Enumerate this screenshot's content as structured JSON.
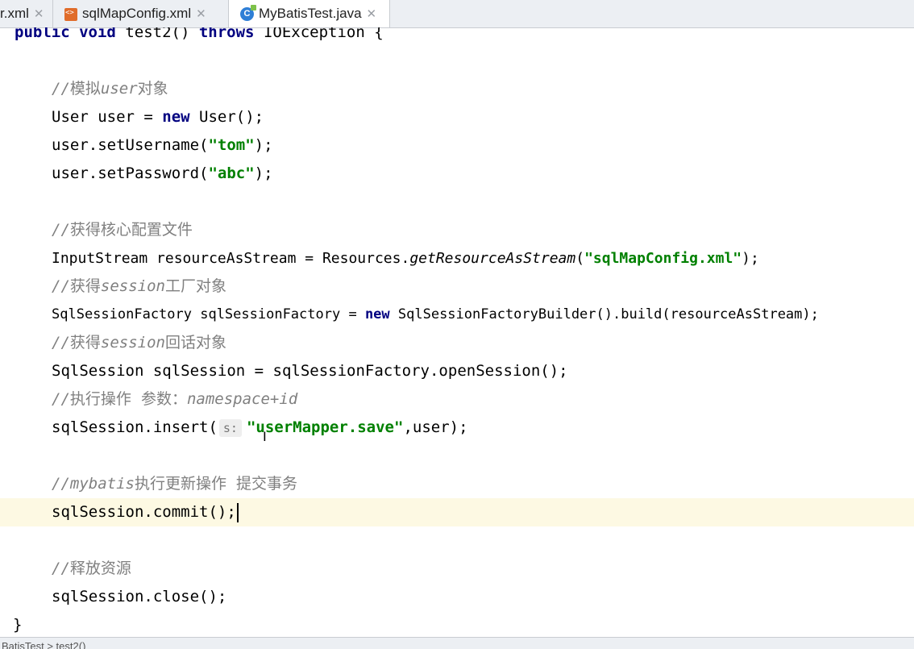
{
  "tabs": [
    {
      "label": "r.xml",
      "icon": "none",
      "active": false
    },
    {
      "label": "sqlMapConfig.xml",
      "icon": "xml-file-icon",
      "active": false
    },
    {
      "label": "MyBatisTest.java",
      "icon": "java-class-icon",
      "active": true
    }
  ],
  "code": {
    "l1": {
      "kw1": "public",
      "kw2": "void",
      "name": "test2()",
      "kw3": "throws",
      "exc": "IOException {"
    },
    "l2": {
      "slashes": "//",
      "c1": "模拟",
      "c2": "user",
      "c3": "对象"
    },
    "l3": {
      "a": "User user = ",
      "kw": "new",
      "b": " User();"
    },
    "l4": {
      "a": "user.setUsername(",
      "s": "\"tom\"",
      "b": ");"
    },
    "l5": {
      "a": "user.setPassword(",
      "s": "\"abc\"",
      "b": ");"
    },
    "l6": {
      "slashes": "//",
      "c1": "获得核心配置文件"
    },
    "l7": {
      "a": "InputStream resourceAsStream = Resources.",
      "m": "getResourceAsStream",
      "b": "(",
      "s": "\"sqlMapConfig.xml\"",
      "c": ");"
    },
    "l8": {
      "slashes": "//",
      "c1": "获得",
      "c2": "session",
      "c3": "工厂对象"
    },
    "l9": {
      "a": "SqlSessionFactory sqlSessionFactory = ",
      "kw": "new",
      "b": " SqlSessionFactoryBuilder().build(resourceAsStream);"
    },
    "l10": {
      "slashes": "//",
      "c1": "获得",
      "c2": "session",
      "c3": "回话对象"
    },
    "l11": {
      "a": "SqlSession sqlSession = sqlSessionFactory.openSession();"
    },
    "l12": {
      "slashes": "//",
      "c1": "执行操作  参数：",
      "c2": "namespace+id"
    },
    "l13": {
      "a": "sqlSession.insert(",
      "hint": "s:",
      "s": "\"userMapper.save\"",
      "b": ",user);"
    },
    "l14": {
      "slashes": "//",
      "c2": "mybatis",
      "c1": "执行更新操作  提交事务"
    },
    "l15": {
      "a": "sqlSession.commit();"
    },
    "l16": {
      "slashes": "//",
      "c1": "释放资源"
    },
    "l17": {
      "a": "sqlSession.close();"
    },
    "l18": {
      "a": "}"
    }
  },
  "status": {
    "text": "BatisTest > test2()"
  }
}
